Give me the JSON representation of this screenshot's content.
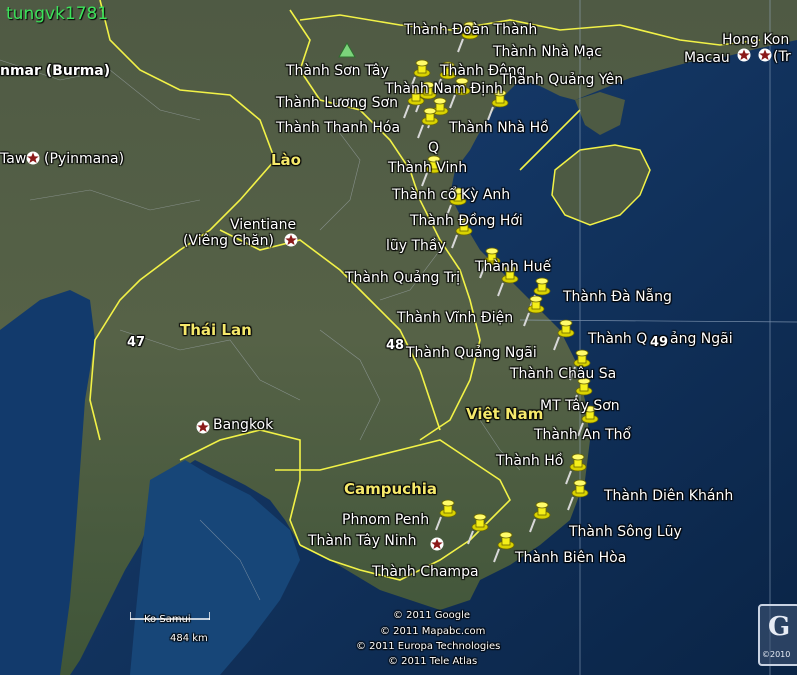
{
  "watermark": "tungvk1781",
  "colors": {
    "sea": "#0e3462",
    "land": "#4a5a44",
    "border": "#f2f247",
    "label": "#ffffff",
    "country_label": "#f5e96b",
    "watermark": "#3ce35a",
    "pin": "#f5ef1a",
    "star": "#8b1a1a"
  },
  "countries": {
    "myanmar": "nmar (Burma)",
    "laos": "Lào",
    "thailand": "Thái Lan",
    "vietnam": "Việt Nam",
    "cambodia": "Campuchia"
  },
  "cities": {
    "hong_kong": "Hong Kon",
    "hong_kong_tail": "(Tr",
    "macau": "Macau",
    "taw": "Taw",
    "pyinmana": "(Pyinmana)",
    "vientiane": "Vientiane",
    "vieng_chan": "(Viêng Chăn)",
    "bangkok": "Bangkok",
    "phnom_penh": "Phnom Penh",
    "ko_samui": "Ko Samui"
  },
  "roads": {
    "r47": "47",
    "r48": "48",
    "r49": "49"
  },
  "placemarks": [
    "Thành Đoàn Thành",
    "Thành Nhà Mạc",
    "Thành Sơn Tây",
    "Thành Đông",
    "Thành Quảng Yên",
    "Thành Nam Định",
    "Thành Lương Sơn",
    "Thành Thanh Hóa",
    "Thành Nhà Hồ",
    "Q",
    "Thành Vinh",
    "Thành cổ Kỳ Anh",
    "Thành Đồng Hới",
    "lũy Thầy",
    "Thành Huế",
    "Thành Quảng Trị",
    "Thành Đà Nẵng",
    "Thành Vĩnh Điện",
    "Thành Quảng Ngãi",
    "Thành Châu Sa",
    "MT Tây Sơn",
    "Thành An Thổ",
    "Thành Hồ",
    "Thành Diên Khánh",
    "Thành Sông Lũy",
    "Thành Tây Ninh",
    "Thành Biên Hòa",
    "Thành Champa",
    "Thành Q",
    "ảng Ngãi"
  ],
  "scale": "484 km",
  "credits": [
    "© 2011 Google",
    "© 2011 Mapabc.com",
    "© 2011 Europa Technologies",
    "© 2011 Tele Atlas"
  ],
  "logo": {
    "glyph": "G",
    "year": "©2010"
  }
}
